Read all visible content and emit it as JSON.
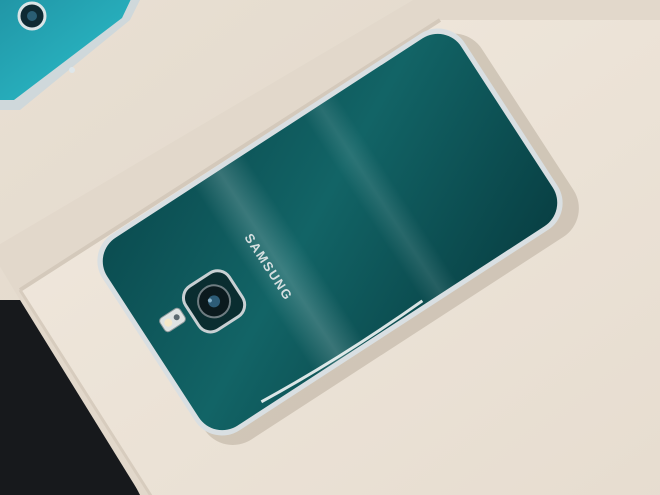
{
  "photo": {
    "brand_text": "SAMSUNG",
    "colors": {
      "background": "#e8dfd2",
      "tray": "#efe6da",
      "tray_shadow": "#d6ccbf",
      "phone_back": "#0f5a5c",
      "phone_back_dark": "#073e42",
      "phone_frame": "#d7dde0",
      "dark_surface": "#15181b"
    }
  }
}
